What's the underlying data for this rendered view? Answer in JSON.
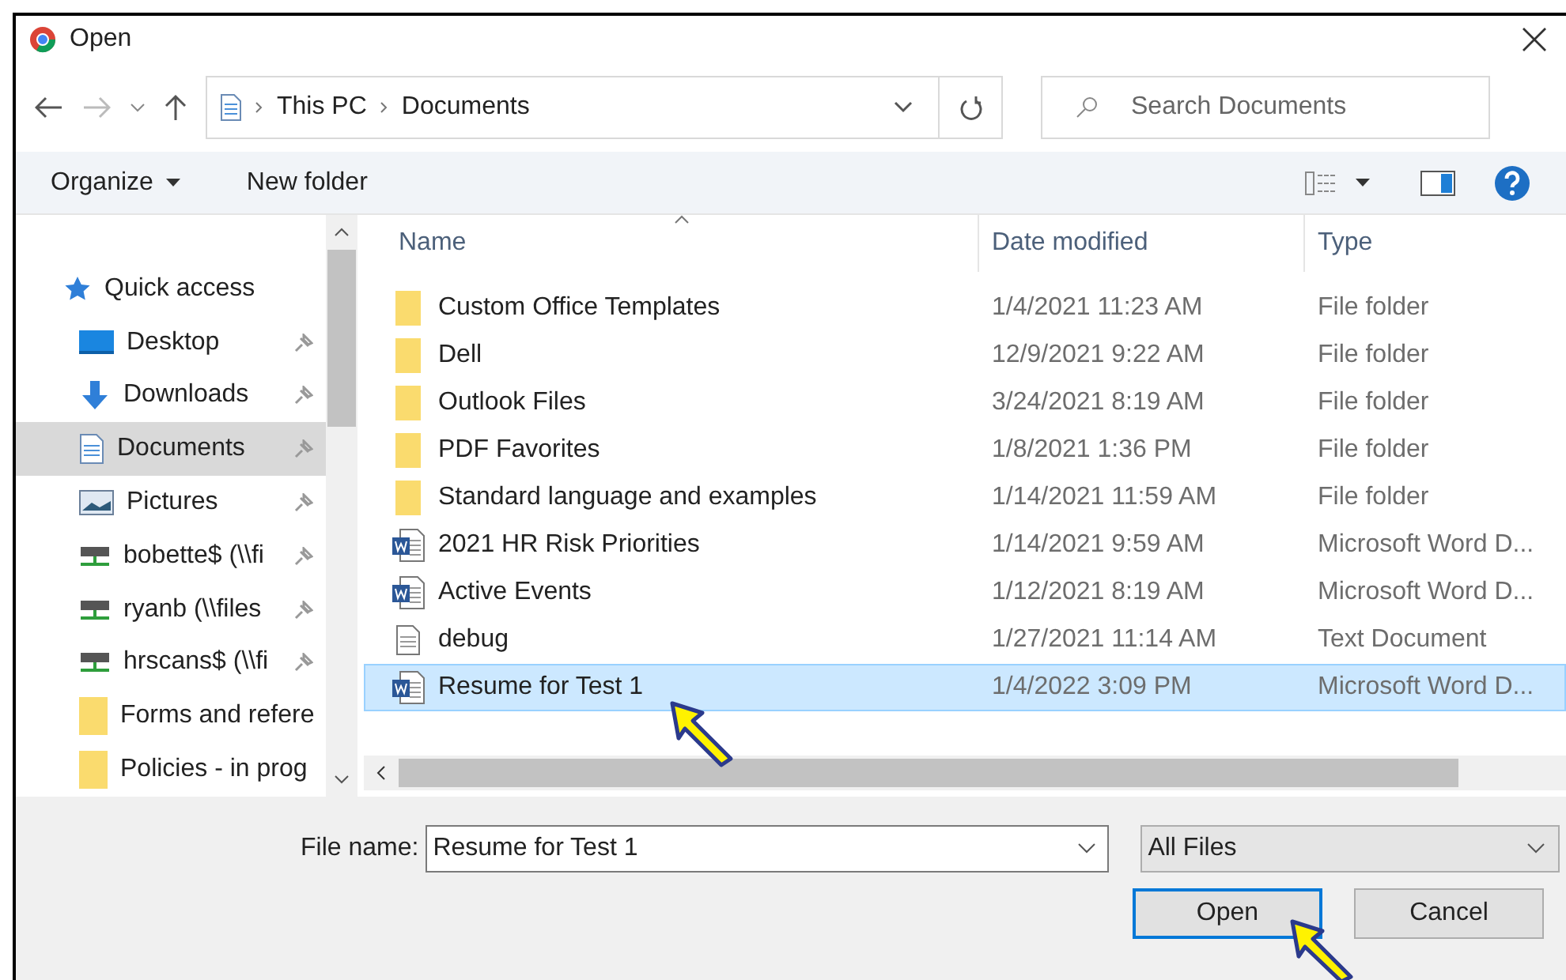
{
  "window": {
    "title": "Open"
  },
  "address": {
    "path": [
      "This PC",
      "Documents"
    ]
  },
  "search": {
    "placeholder": "Search Documents"
  },
  "toolbar": {
    "organize": "Organize",
    "new_folder": "New folder"
  },
  "sidebar": {
    "items": [
      {
        "label": "Quick access",
        "kind": "star",
        "pinned": false,
        "selected": false
      },
      {
        "label": "Desktop",
        "kind": "desktop",
        "pinned": true,
        "selected": false
      },
      {
        "label": "Downloads",
        "kind": "download",
        "pinned": true,
        "selected": false
      },
      {
        "label": "Documents",
        "kind": "document",
        "pinned": true,
        "selected": true
      },
      {
        "label": "Pictures",
        "kind": "picture",
        "pinned": true,
        "selected": false
      },
      {
        "label": "bobette$ (\\\\fi",
        "kind": "drive",
        "pinned": true,
        "selected": false
      },
      {
        "label": "ryanb (\\\\files",
        "kind": "drive",
        "pinned": true,
        "selected": false
      },
      {
        "label": "hrscans$ (\\\\fi",
        "kind": "drive",
        "pinned": true,
        "selected": false
      },
      {
        "label": "Forms and refere",
        "kind": "folder",
        "pinned": false,
        "selected": false
      },
      {
        "label": "Policies - in prog",
        "kind": "folder",
        "pinned": false,
        "selected": false
      }
    ]
  },
  "table": {
    "columns": [
      "Name",
      "Date modified",
      "Type"
    ],
    "rows": [
      {
        "name": "Custom Office Templates",
        "date": "1/4/2021 11:23 AM",
        "type": "File folder",
        "kind": "folder",
        "selected": false
      },
      {
        "name": "Dell",
        "date": "12/9/2021 9:22 AM",
        "type": "File folder",
        "kind": "folder",
        "selected": false
      },
      {
        "name": "Outlook Files",
        "date": "3/24/2021 8:19 AM",
        "type": "File folder",
        "kind": "folder",
        "selected": false
      },
      {
        "name": "PDF Favorites",
        "date": "1/8/2021 1:36 PM",
        "type": "File folder",
        "kind": "folder",
        "selected": false
      },
      {
        "name": "Standard language and examples",
        "date": "1/14/2021 11:59 AM",
        "type": "File folder",
        "kind": "folder",
        "selected": false
      },
      {
        "name": "2021 HR Risk Priorities",
        "date": "1/14/2021 9:59 AM",
        "type": "Microsoft Word D...",
        "kind": "word",
        "selected": false
      },
      {
        "name": "Active Events",
        "date": "1/12/2021 8:19 AM",
        "type": "Microsoft Word D...",
        "kind": "word",
        "selected": false
      },
      {
        "name": "debug",
        "date": "1/27/2021 11:14 AM",
        "type": "Text Document",
        "kind": "text",
        "selected": false
      },
      {
        "name": "Resume for Test 1",
        "date": "1/4/2022 3:09 PM",
        "type": "Microsoft Word D...",
        "kind": "word",
        "selected": true
      }
    ]
  },
  "file_name": {
    "label": "File name:",
    "value": "Resume for Test 1"
  },
  "file_type": {
    "value": "All Files"
  },
  "buttons": [
    {
      "label": "Open",
      "default": true
    },
    {
      "label": "Cancel",
      "default": false
    }
  ]
}
